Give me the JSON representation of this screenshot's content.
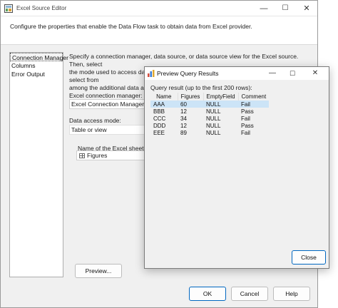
{
  "window": {
    "title": "Excel Source Editor",
    "minimize": "—",
    "maximize": "☐",
    "close": "✕"
  },
  "description": "Configure the properties that enable the Data Flow task to obtain data from Excel provider.",
  "nav": {
    "items": [
      "Connection Manager",
      "Columns",
      "Error Output"
    ]
  },
  "intro_line1": "Specify a connection manager, data source, or data source view for the Excel source. Then, select",
  "intro_line2": "the mode used to access data within the source. After selecting the data access mode, select from",
  "intro_line3": "among the additional data access",
  "connection_manager": {
    "label": "Excel connection manager:",
    "value": "Excel Connection Manager"
  },
  "data_access": {
    "label": "Data access mode:",
    "value": "Table or view"
  },
  "sheet": {
    "label": "Name of the Excel sheet:",
    "value": "Figures"
  },
  "buttons": {
    "preview": "Preview...",
    "ok": "OK",
    "cancel": "Cancel",
    "help": "Help"
  },
  "preview_dialog": {
    "title": "Preview Query Results",
    "minimize": "—",
    "maximize": "☐",
    "close_x": "✕",
    "caption": "Query result (up to the first 200 rows):",
    "columns": [
      "Name",
      "Figures",
      "EmptyField",
      "Comment"
    ],
    "rows": [
      [
        "AAA",
        "60",
        "NULL",
        "Fail"
      ],
      [
        "BBB",
        "12",
        "NULL",
        "Pass"
      ],
      [
        "CCC",
        "34",
        "NULL",
        "Fail"
      ],
      [
        "DDD",
        "12",
        "NULL",
        "Pass"
      ],
      [
        "EEE",
        "89",
        "NULL",
        "Fail"
      ]
    ],
    "close_button": "Close"
  },
  "colors": {
    "accent": "#0067c0",
    "selection": "#cce4f7",
    "background": "#f0f0f0"
  }
}
